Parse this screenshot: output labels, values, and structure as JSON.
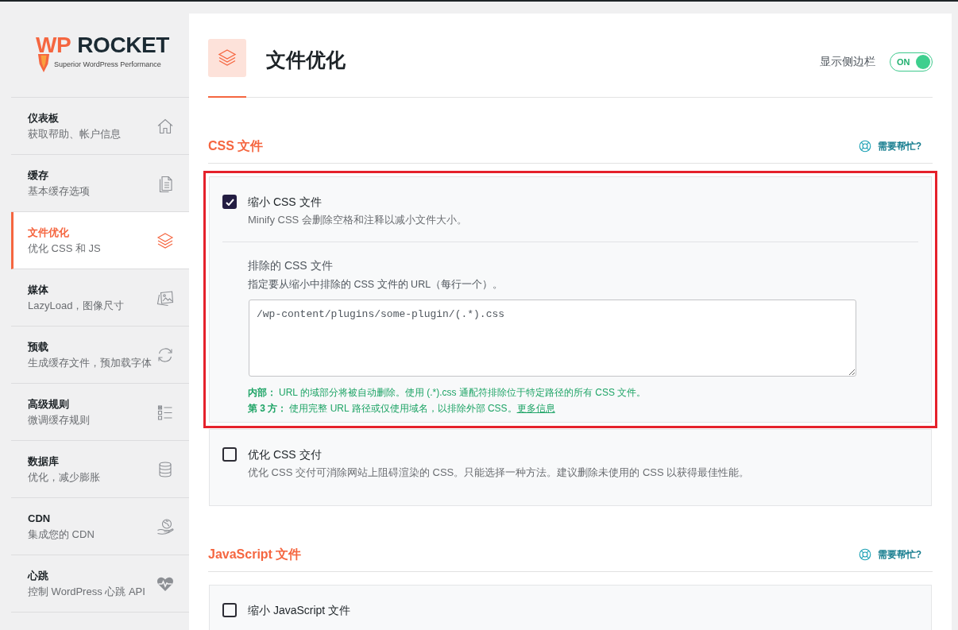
{
  "sidebar": {
    "logo": {
      "accent": "WP",
      "name": "ROCKET",
      "tagline": "Superior WordPress Performance"
    },
    "items": [
      {
        "title": "仪表板",
        "subtitle": "获取帮助、帐户信息",
        "selected": false
      },
      {
        "title": "缓存",
        "subtitle": "基本缓存选项",
        "selected": false
      },
      {
        "title": "文件优化",
        "subtitle": "优化 CSS 和 JS",
        "selected": true
      },
      {
        "title": "媒体",
        "subtitle": "LazyLoad，图像尺寸",
        "selected": false
      },
      {
        "title": "预载",
        "subtitle": "生成缓存文件，预加载字体",
        "selected": false
      },
      {
        "title": "高级规则",
        "subtitle": "微调缓存规则",
        "selected": false
      },
      {
        "title": "数据库",
        "subtitle": "优化，减少膨胀",
        "selected": false
      },
      {
        "title": "CDN",
        "subtitle": "集成您的 CDN",
        "selected": false
      },
      {
        "title": "心跳",
        "subtitle": "控制 WordPress 心跳 API",
        "selected": false
      }
    ]
  },
  "header": {
    "title": "文件优化",
    "sidebar_toggle": {
      "label": "显示侧边栏",
      "state_label": "ON",
      "on": true
    }
  },
  "sections": [
    {
      "title": "CSS 文件",
      "help": "需要帮忙?",
      "options": [
        {
          "label": "缩小 CSS 文件",
          "description": "Minify CSS 会删除空格和注释以减小文件大小。",
          "checked": true,
          "highlighted": true,
          "exclusions": {
            "label": "排除的 CSS 文件",
            "description": "指定要从缩小中排除的 CSS 文件的 URL（每行一个）。",
            "value": "/wp-content/plugins/some-plugin/(.*).css",
            "notes": [
              {
                "lead": "内部：",
                "text": "URL 的域部分将被自动删除。使用 (.*).css 通配符排除位于特定路径的所有 CSS 文件。"
              },
              {
                "lead": "第 3 方：",
                "text": "使用完整 URL 路径或仅使用域名，以排除外部 CSS。",
                "link": "更多信息"
              }
            ]
          }
        },
        {
          "label": "优化 CSS 交付",
          "description": "优化 CSS 交付可消除网站上阻碍渲染的 CSS。只能选择一种方法。建议删除未使用的 CSS 以获得最佳性能。",
          "checked": false,
          "highlighted": false
        }
      ]
    },
    {
      "title": "JavaScript 文件",
      "help": "需要帮忙?",
      "options": [
        {
          "label": "缩小 JavaScript 文件",
          "checked": false,
          "highlighted": false
        }
      ]
    }
  ]
}
